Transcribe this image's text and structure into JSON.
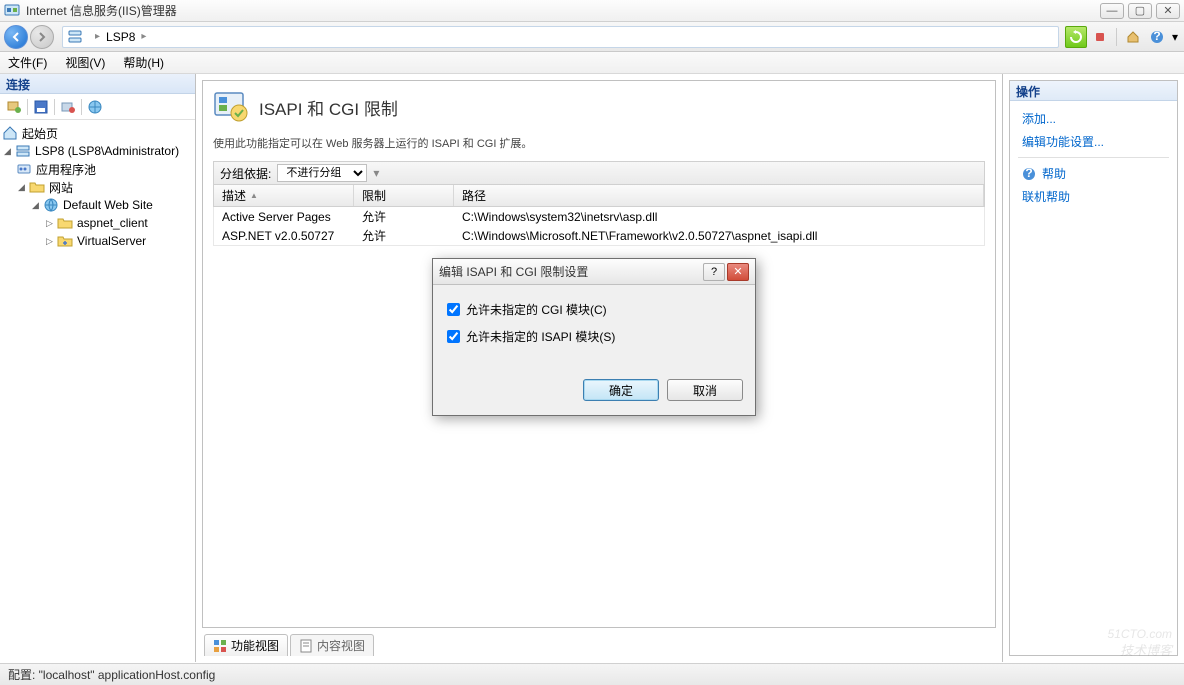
{
  "window": {
    "title": "Internet 信息服务(IIS)管理器"
  },
  "breadcrumb": {
    "node": "LSP8"
  },
  "menu": {
    "file": "文件(F)",
    "view": "视图(V)",
    "help": "帮助(H)"
  },
  "leftpanel": {
    "header": "连接",
    "tree": {
      "start": "起始页",
      "server": "LSP8 (LSP8\\Administrator)",
      "apppools": "应用程序池",
      "sites": "网站",
      "defaultsite": "Default Web Site",
      "aspnet_client": "aspnet_client",
      "virtualserver": "VirtualServer"
    }
  },
  "center": {
    "title": "ISAPI 和 CGI 限制",
    "desc": "使用此功能指定可以在 Web 服务器上运行的 ISAPI 和 CGI 扩展。",
    "groupby_label": "分组依据:",
    "groupby_value": "不进行分组",
    "cols": {
      "desc": "描述",
      "restrict": "限制",
      "path": "路径"
    },
    "rows": [
      {
        "desc": "Active Server Pages",
        "restrict": "允许",
        "path": "C:\\Windows\\system32\\inetsrv\\asp.dll"
      },
      {
        "desc": "ASP.NET v2.0.50727",
        "restrict": "允许",
        "path": "C:\\Windows\\Microsoft.NET\\Framework\\v2.0.50727\\aspnet_isapi.dll"
      }
    ],
    "tab_features": "功能视图",
    "tab_content": "内容视图"
  },
  "rightpanel": {
    "header": "操作",
    "add": "添加...",
    "editfeat": "编辑功能设置...",
    "help": "帮助",
    "onlinehelp": "联机帮助"
  },
  "dialog": {
    "title": "编辑 ISAPI 和 CGI 限制设置",
    "chk_cgi": "允许未指定的 CGI 模块(C)",
    "chk_isapi": "允许未指定的 ISAPI 模块(S)",
    "ok": "确定",
    "cancel": "取消"
  },
  "status": {
    "text": "配置: \"localhost\" applicationHost.config"
  },
  "watermark": {
    "main": "51CTO.com",
    "sub": "技术博客"
  }
}
